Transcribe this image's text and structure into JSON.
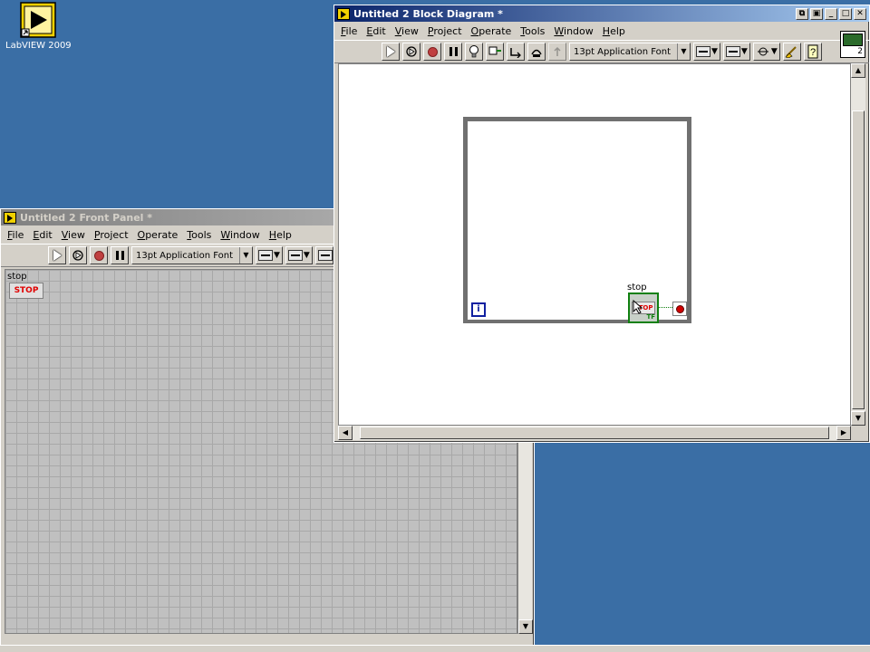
{
  "desktop": {
    "icon_label": "LabVIEW 2009"
  },
  "front_panel": {
    "title": "Untitled 2 Front Panel *",
    "menu": [
      "File",
      "Edit",
      "View",
      "Project",
      "Operate",
      "Tools",
      "Window",
      "Help"
    ],
    "font_selector": "13pt Application Font",
    "controls": {
      "stop_label": "stop",
      "stop_button_text": "STOP"
    }
  },
  "block_diagram": {
    "title": "Untitled 2 Block Diagram *",
    "menu": [
      "File",
      "Edit",
      "View",
      "Project",
      "Operate",
      "Tools",
      "Window",
      "Help"
    ],
    "font_selector": "13pt Application Font",
    "connector_pane_number": "2",
    "loop": {
      "iteration_label": "i",
      "stop_label": "stop",
      "stop_terminal_text": "STOP",
      "stop_terminal_type": "TF"
    }
  },
  "colors": {
    "desktop": "#3a6ea5",
    "active_title": "#0a246a",
    "inactive_title": "#808080",
    "boolean_wire": "#108010",
    "stop_red": "#e00000"
  }
}
